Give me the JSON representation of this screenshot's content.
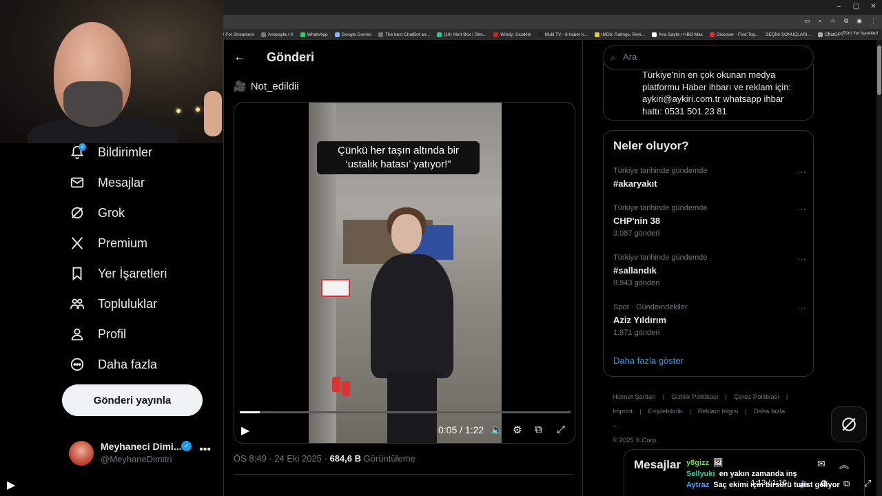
{
  "browser": {
    "window_controls": [
      "–",
      "▢",
      "✕"
    ],
    "bookmarks": [
      "l For Streamers",
      "Anasayfa / X",
      "WhatsApp",
      "Google Gemini",
      "The best ChatBot an...",
      "(19) Alert Box / Stre...",
      "Windy: Sıcaklık",
      "Multi TV - 6 haber k...",
      "IMDb: Ratings, Revi...",
      "Ana Sayfa • HBO Max",
      "Discover - Find Top...",
      "SEÇİM SONUÇLARI...",
      "ChatGPT"
    ],
    "bookmarks_overflow": "»",
    "all_bookmarks": "Tüm Yer İşaretleri"
  },
  "nav": {
    "notification_badge": "2",
    "items": [
      {
        "label": "Bildirimler"
      },
      {
        "label": "Mesajlar"
      },
      {
        "label": "Grok"
      },
      {
        "label": "Premium"
      },
      {
        "label": "Yer İşaretleri"
      },
      {
        "label": "Topluluklar"
      },
      {
        "label": "Profil"
      },
      {
        "label": "Daha fazla"
      }
    ],
    "post_button": "Gönderi yayınla",
    "profile": {
      "name": "Meyhaneci Dimi...",
      "handle": "@MeyhaneDimitri",
      "avatar_text": "DIMITRI"
    }
  },
  "main": {
    "title": "Gönderi",
    "caption_emoji": "🎥",
    "caption": "Not_edildii",
    "video": {
      "overlay_text": "Çünkü her taşın altında bir ‘ustalık hatası’ yatıyor!\"",
      "current_time": "0:05 / 1:22",
      "progress": 0.06
    },
    "meta_time": "ÖS 8:49 · 24 Eki 2025 · ",
    "meta_views": "684,6 B",
    "meta_views_label": " Görüntüleme"
  },
  "sidebar": {
    "search_placeholder": "Ara",
    "bio_line1": "Türkiye'nin en çok okunan medya",
    "bio_line2": "platformu Haber ihbarı ve reklam için:",
    "bio_line3": "aykiri@aykiri.com.tr whatsapp ihbar",
    "bio_line4": "hattı: 0531 501 23 81",
    "trends_title": "Neler oluyor?",
    "trends": [
      {
        "category": "Türkiye tarihinde gündemde",
        "topic": "#akaryakıt",
        "count": ""
      },
      {
        "category": "Türkiye tarihinde gündemde",
        "topic": "CHP'nin 38",
        "count": "3.087 gönderi"
      },
      {
        "category": "Türkiye tarihinde gündemde",
        "topic": "#sallandık",
        "count": "9.943 gönderi"
      },
      {
        "category": "Spor · Gündemdekiler",
        "topic": "Aziz Yıldırım",
        "count": "1.871 gönderi"
      }
    ],
    "show_more": "Daha fazla göster",
    "footer": [
      "Hizmet Şartları",
      "|",
      "Gizlilik Politikası",
      "|",
      "Çerez Politikası",
      "|",
      "Imprint",
      "|",
      "Erişilebilirlik",
      "|",
      "Reklam bilgisi",
      "|",
      "Daha fazla ···",
      "© 2025 X Corp."
    ],
    "messages_title": "Mesajlar"
  },
  "stream_chat": [
    {
      "user": "y8gizz",
      "user_color": "#7bdc3c",
      "message": "🖼"
    },
    {
      "user": "Sellyuki",
      "user_color": "#34d399",
      "message": "en yakın zamanda inş"
    },
    {
      "user": "Aytraz",
      "user_color": "#4aa3ff",
      "message": "Saç ekimi için birsürü turist geliyor"
    }
  ],
  "player": {
    "time": "1:13 / 1:16"
  },
  "colors": {
    "accent": "#1d9bf0",
    "background": "#000000",
    "border": "#2f3336",
    "muted": "#71767b"
  }
}
